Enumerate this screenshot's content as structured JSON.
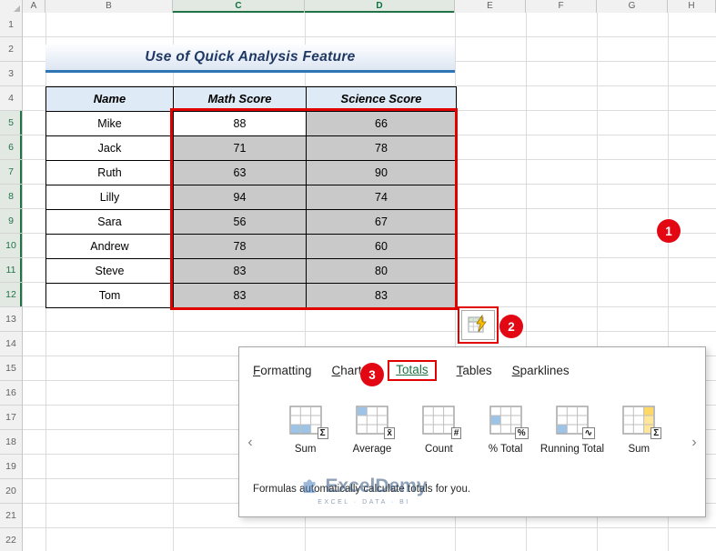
{
  "spreadsheet": {
    "columns": [
      "A",
      "B",
      "C",
      "D",
      "E",
      "F",
      "G",
      "H"
    ],
    "rows": [
      "1",
      "2",
      "3",
      "4",
      "5",
      "6",
      "7",
      "8",
      "9",
      "10",
      "11",
      "12",
      "13",
      "14",
      "15",
      "16",
      "17",
      "18",
      "19",
      "20",
      "21",
      "22"
    ]
  },
  "title": {
    "text": "Use of Quick Analysis Feature"
  },
  "table": {
    "headers": [
      "Name",
      "Math Score",
      "Science Score"
    ],
    "rows": [
      [
        "Mike",
        "88",
        "66"
      ],
      [
        "Jack",
        "71",
        "78"
      ],
      [
        "Ruth",
        "63",
        "90"
      ],
      [
        "Lilly",
        "94",
        "74"
      ],
      [
        "Sara",
        "56",
        "67"
      ],
      [
        "Andrew",
        "78",
        "60"
      ],
      [
        "Steve",
        "83",
        "80"
      ],
      [
        "Tom",
        "83",
        "83"
      ]
    ]
  },
  "annotations": {
    "step1": "1",
    "step2": "2",
    "step3": "3"
  },
  "quick_analysis": {
    "tabs": [
      {
        "first": "F",
        "rest": "ormatting"
      },
      {
        "first": "C",
        "rest": "harts"
      },
      {
        "first": "T",
        "rest": "otals"
      },
      {
        "first": "T",
        "rest": "ables"
      },
      {
        "first": "S",
        "rest": "parklines"
      }
    ],
    "selected_tab": "Totals",
    "items": [
      {
        "label": "Sum",
        "symbol": "Σ"
      },
      {
        "label": "Average",
        "symbol": "x̄"
      },
      {
        "label": "Count",
        "symbol": "#"
      },
      {
        "label": "% Total",
        "symbol": "%"
      },
      {
        "label": "Running Total",
        "symbol": "∿"
      },
      {
        "label": "Sum",
        "symbol": "Σ"
      }
    ],
    "nav_left": "‹",
    "nav_right": "›",
    "footer": "Formulas automatically calculate totals for you."
  },
  "watermark": {
    "text": "ExcelDemy",
    "subtext": "EXCEL · DATA · BI"
  },
  "colors": {
    "accent_red": "#E00000",
    "excel_green": "#217346",
    "selection_gray": "#C9C9C9",
    "header_blue": "#DEEAF6",
    "title_navy": "#1F3864"
  }
}
